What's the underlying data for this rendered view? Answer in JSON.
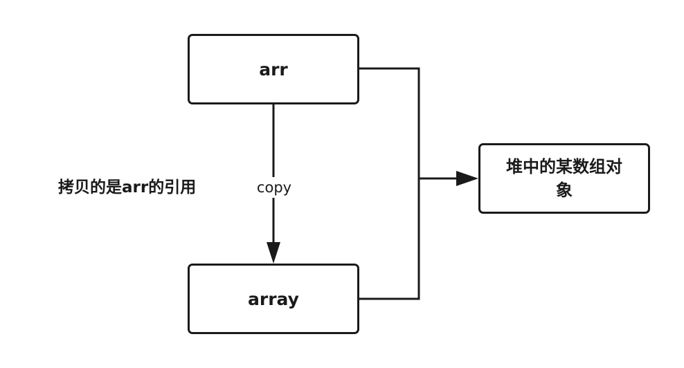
{
  "nodes": {
    "arr": "arr",
    "array": "array",
    "heap_object": "堆中的某数组对象"
  },
  "edges": {
    "copy_label": "copy"
  },
  "annotation": "拷贝的是arr的引用",
  "colors": {
    "stroke": "#1a1a1a",
    "background": "#ffffff"
  }
}
